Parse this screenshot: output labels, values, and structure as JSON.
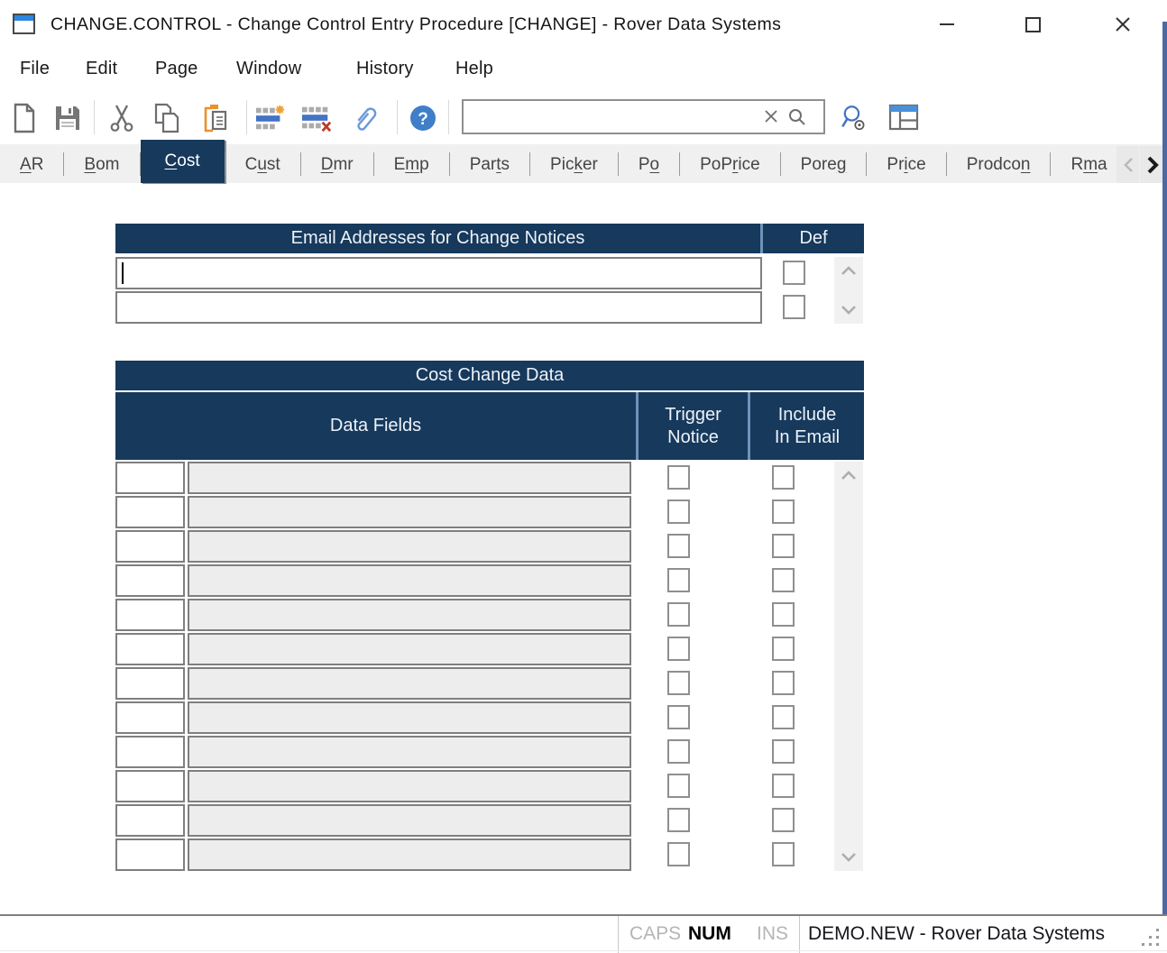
{
  "window": {
    "title": "CHANGE.CONTROL - Change Control Entry Procedure [CHANGE] - Rover Data Systems"
  },
  "menu": {
    "items": [
      "File",
      "Edit",
      "Page",
      "Window",
      "History",
      "Help"
    ]
  },
  "toolbar": {
    "icons": [
      "new-document",
      "save",
      "cut",
      "copy",
      "paste",
      "insert-row",
      "delete-row",
      "attachment",
      "help",
      "clear-search",
      "search",
      "advanced-search",
      "layout"
    ],
    "search": {
      "value": "",
      "placeholder": ""
    }
  },
  "tabs": {
    "items": [
      {
        "label": "AR",
        "mnemonic_index": 0,
        "selected": false
      },
      {
        "label": "Bom",
        "mnemonic_index": 0,
        "selected": false
      },
      {
        "label": "Cost",
        "mnemonic_index": 0,
        "selected": true
      },
      {
        "label": "Cust",
        "mnemonic_index": 1,
        "selected": false
      },
      {
        "label": "Dmr",
        "mnemonic_index": 0,
        "selected": false
      },
      {
        "label": "Emp",
        "mnemonic_index": 1,
        "selected": false
      },
      {
        "label": "Parts",
        "mnemonic_index": 3,
        "selected": false
      },
      {
        "label": "Picker",
        "mnemonic_index": 3,
        "selected": false
      },
      {
        "label": "Po",
        "mnemonic_index": 1,
        "selected": false
      },
      {
        "label": "PoPrice",
        "mnemonic_index": 3,
        "selected": false
      },
      {
        "label": "Poreg",
        "mnemonic_index": 4,
        "selected": false
      },
      {
        "label": "Price",
        "mnemonic_index": 2,
        "selected": false
      },
      {
        "label": "Prodcon",
        "mnemonic_index": 6,
        "selected": false
      },
      {
        "label": "Rma",
        "mnemonic_index": 1,
        "selected": false
      }
    ]
  },
  "email_table": {
    "header": "Email Addresses for Change Notices",
    "def_header": "Def",
    "rows": [
      {
        "email": "",
        "def_checked": false,
        "focused": true
      },
      {
        "email": "",
        "def_checked": false,
        "focused": false
      }
    ]
  },
  "cost_table": {
    "title": "Cost Change Data",
    "col_data_fields": "Data Fields",
    "col_trigger": "Trigger Notice",
    "col_include": "Include In Email",
    "rows": [
      {
        "code": "",
        "field": "",
        "trigger_checked": false,
        "include_checked": false
      },
      {
        "code": "",
        "field": "",
        "trigger_checked": false,
        "include_checked": false
      },
      {
        "code": "",
        "field": "",
        "trigger_checked": false,
        "include_checked": false
      },
      {
        "code": "",
        "field": "",
        "trigger_checked": false,
        "include_checked": false
      },
      {
        "code": "",
        "field": "",
        "trigger_checked": false,
        "include_checked": false
      },
      {
        "code": "",
        "field": "",
        "trigger_checked": false,
        "include_checked": false
      },
      {
        "code": "",
        "field": "",
        "trigger_checked": false,
        "include_checked": false
      },
      {
        "code": "",
        "field": "",
        "trigger_checked": false,
        "include_checked": false
      },
      {
        "code": "",
        "field": "",
        "trigger_checked": false,
        "include_checked": false
      },
      {
        "code": "",
        "field": "",
        "trigger_checked": false,
        "include_checked": false
      },
      {
        "code": "",
        "field": "",
        "trigger_checked": false,
        "include_checked": false
      },
      {
        "code": "",
        "field": "",
        "trigger_checked": false,
        "include_checked": false
      }
    ]
  },
  "statusbar": {
    "caps": "CAPS",
    "num": "NUM",
    "ins": "INS",
    "caps_active": false,
    "num_active": true,
    "ins_active": false,
    "message": "DEMO.NEW - Rover Data Systems"
  },
  "colors": {
    "header_navy": "#16395c",
    "header_separator": "#6e93bb",
    "toolbar_blue": "#4472c4",
    "paste_orange": "#e8912d",
    "delete_red": "#c0392b",
    "window_border": "#4b69a2",
    "disabled_field": "#ededed",
    "field_border": "#7f7f7f"
  }
}
